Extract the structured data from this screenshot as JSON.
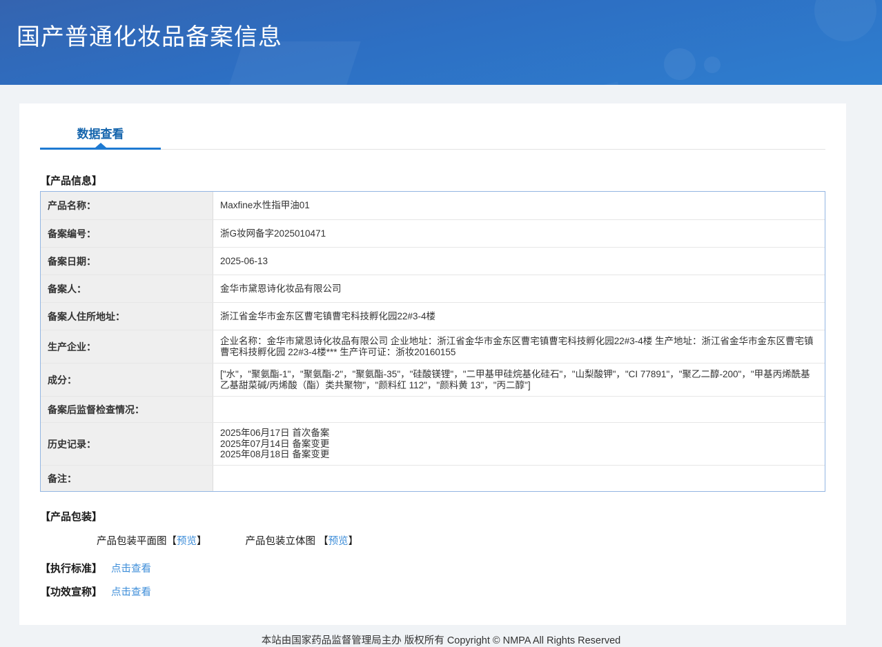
{
  "page": {
    "title": "国产普通化妆品备案信息",
    "footer": "本站由国家药品监督管理局主办 版权所有 Copyright © NMPA All Rights Reserved"
  },
  "colors": {
    "header_blue_top": "#3464b0",
    "header_blue_bottom": "#2e7ecf",
    "accent_blue": "#1e7ad2",
    "tab_text_blue": "#1565ad",
    "link_blue": "#3e8ed9",
    "table_border_blue": "#93b5e2",
    "label_cell_gray": "#efefef",
    "page_background": "#f0f3f6"
  },
  "tabs": {
    "data_view": "数据查看"
  },
  "product_info": {
    "heading": "【产品信息】",
    "rows": [
      {
        "label": "产品名称：",
        "value": "Maxfine水性指甲油01"
      },
      {
        "label": "备案编号：",
        "value": "浙G妆网备字2025010471"
      },
      {
        "label": "备案日期：",
        "value": "2025-06-13"
      },
      {
        "label": "备案人：",
        "value": "金华市黛恩诗化妆品有限公司"
      },
      {
        "label": "备案人住所地址：",
        "value": "浙江省金华市金东区曹宅镇曹宅科技孵化园22#3-4楼"
      },
      {
        "label": "生产企业：",
        "value": "企业名称：金华市黛恩诗化妆品有限公司 企业地址：浙江省金华市金东区曹宅镇曹宅科技孵化园22#3-4楼 生产地址：浙江省金华市金东区曹宅镇曹宅科技孵化园 22#3-4楼*** 生产许可证：浙妆20160155"
      },
      {
        "label": "成分：",
        "value": "[\"水\"，\"聚氨酯-1\"，\"聚氨酯-2\"，\"聚氨酯-35\"，\"硅酸镁锂\"，\"二甲基甲硅烷基化硅石\"，\"山梨酸钾\"，\"CI 77891\"，\"聚乙二醇-200\"，\"甲基丙烯酰基乙基甜菜碱/丙烯酸（酯）类共聚物\"，\"颜料红 112\"，\"颜料黄 13\"，\"丙二醇\"]"
      },
      {
        "label": "备案后监督检查情况：",
        "value": ""
      },
      {
        "label": "历史记录：",
        "value": "2025年06月17日 首次备案\n2025年07月14日 备案变更\n2025年08月18日 备案变更"
      },
      {
        "label": "备注：",
        "value": ""
      }
    ]
  },
  "packaging": {
    "heading": "【产品包装】",
    "items": [
      {
        "label": "产品包装平面图",
        "bracket_open": "【",
        "link": "预览",
        "bracket_close": "】"
      },
      {
        "label": "产品包装立体图 ",
        "bracket_open": "【",
        "link": "预览",
        "bracket_close": "】"
      }
    ]
  },
  "standards": {
    "heading": "【执行标准】",
    "link": "点击查看"
  },
  "efficacy": {
    "heading": "【功效宣称】",
    "link": "点击查看"
  }
}
